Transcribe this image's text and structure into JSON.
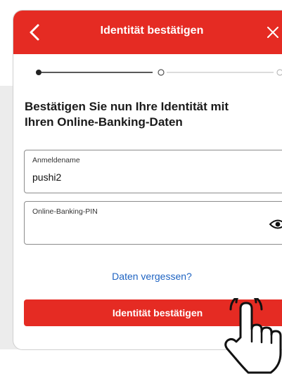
{
  "header": {
    "title": "Identität bestätigen",
    "back_icon": "chevron-left-icon",
    "close_icon": "close-icon",
    "color": "#e52b23"
  },
  "stepper": {
    "steps": 3,
    "current_step": 1
  },
  "main": {
    "heading_line1": "Bestätigen Sie nun Ihre Identität mit",
    "heading_line2": "Ihren Online-Banking-Daten",
    "username_field": {
      "label": "Anmeldename",
      "value": "pushi2"
    },
    "pin_field": {
      "label": "Online-Banking-PIN",
      "value": "",
      "icon": "eye-icon"
    },
    "forgot_link": "Daten vergessen?",
    "confirm_button": "Identität bestätigen"
  },
  "overlay": {
    "icon": "pointing-hand-icon"
  },
  "colors": {
    "accent": "#e52b23",
    "link": "#1e63c2"
  }
}
